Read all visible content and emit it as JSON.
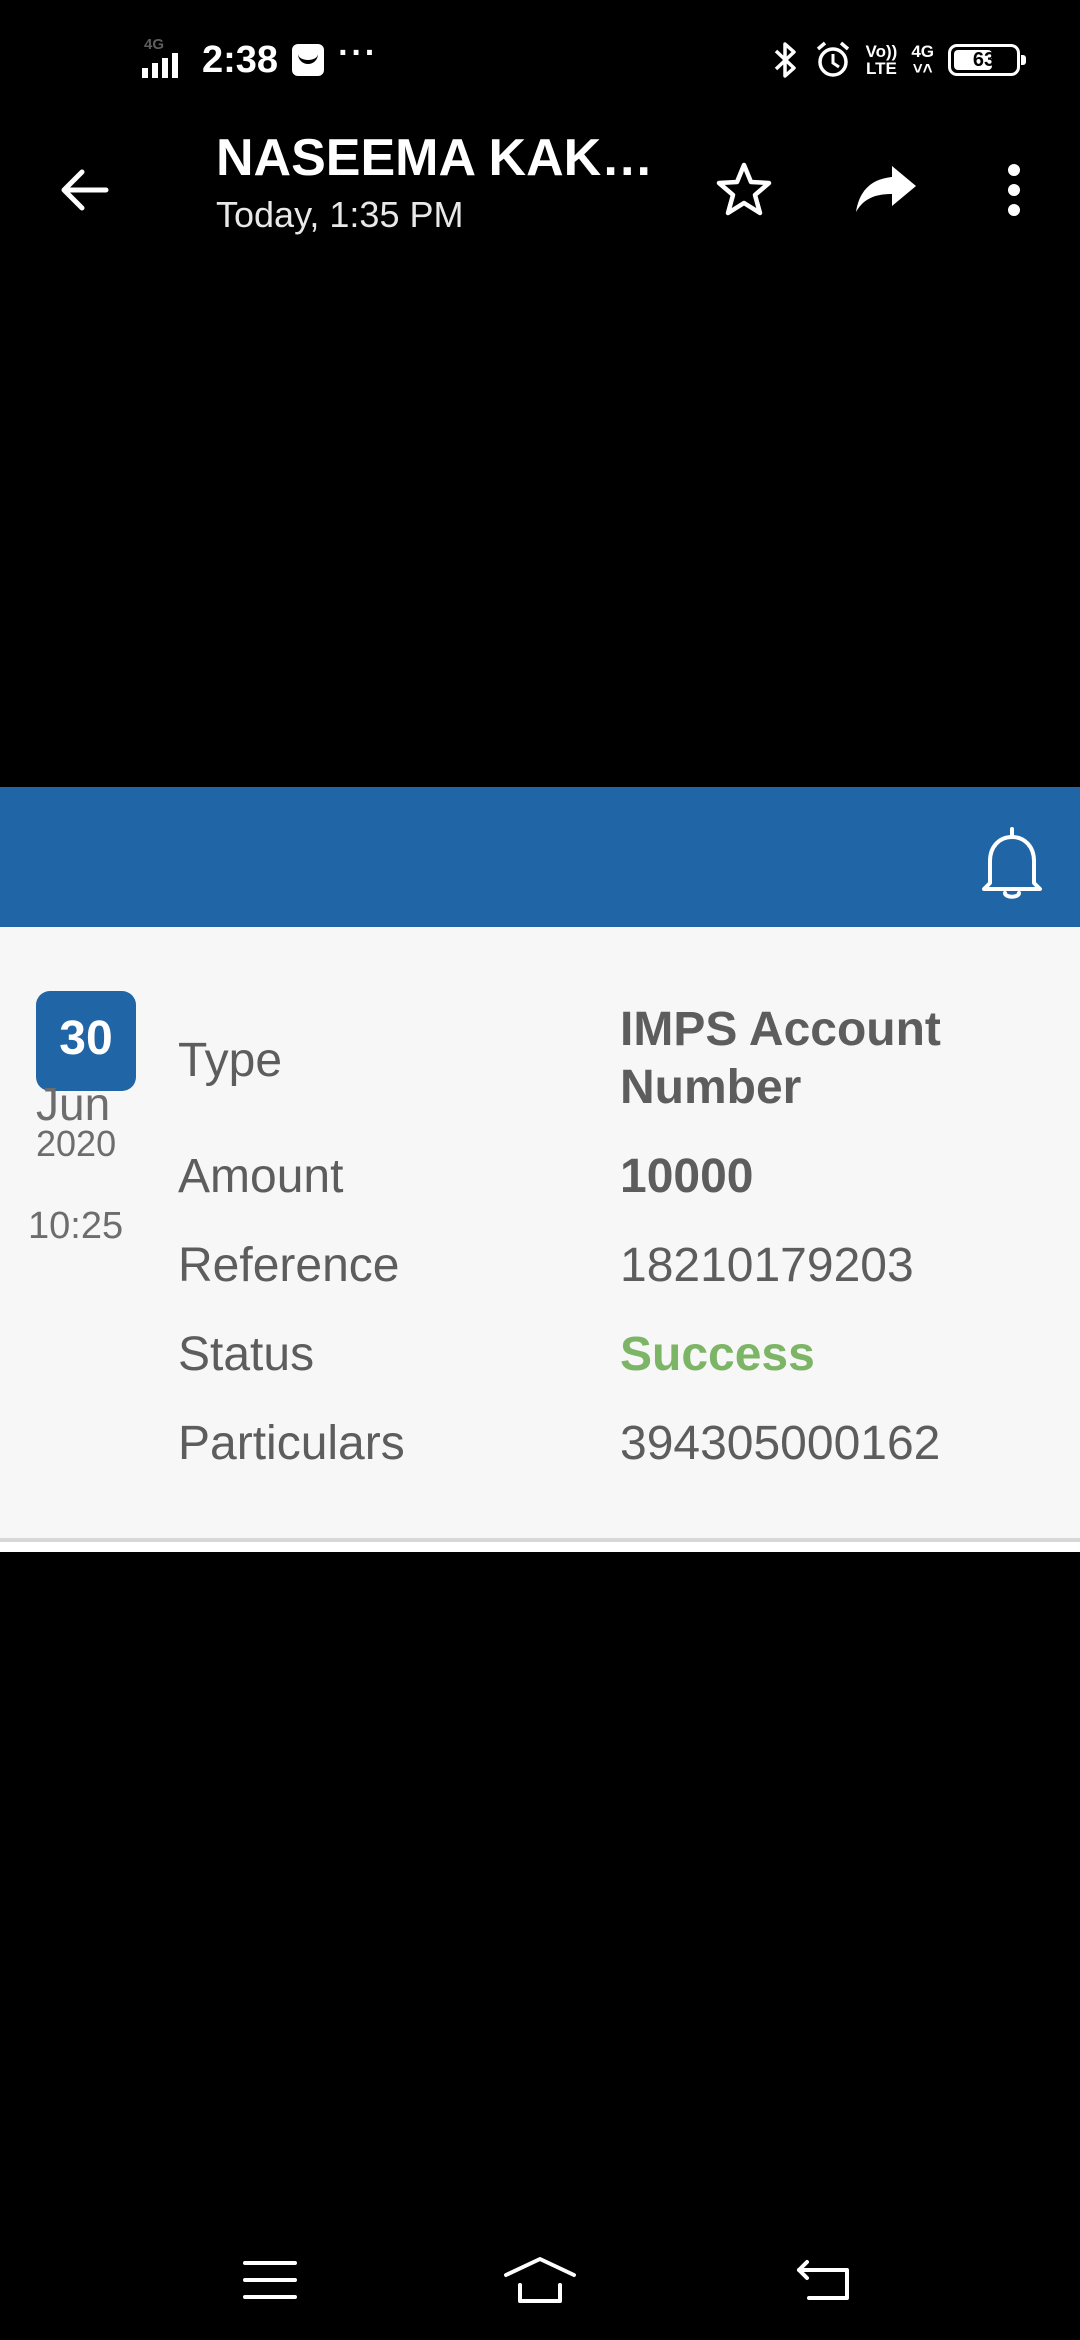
{
  "status_bar": {
    "network_label": "4G",
    "time": "2:38",
    "more": "···",
    "volte_line1": "Vo))",
    "volte_line2": "LTE",
    "net2_line1": "4G",
    "net2_line2": "˅˄",
    "battery_percent": "63",
    "battery_level": 0.63,
    "icons": [
      "signal-icon",
      "message-icon",
      "bluetooth-icon",
      "alarm-icon",
      "volte-icon",
      "battery-icon"
    ]
  },
  "toolbar": {
    "title": "NASEEMA KAKK...",
    "subtitle": "Today, 1:35 PM",
    "icons": [
      "back-arrow-icon",
      "star-icon",
      "share-icon",
      "more-vert-icon"
    ]
  },
  "header_bar": {
    "color": "#2065a5",
    "icon": "bell-icon"
  },
  "transaction": {
    "day": "30",
    "month": "Jun",
    "year": "2020",
    "time": "10:25",
    "rows": [
      {
        "label": "Type",
        "value": "IMPS Account Number"
      },
      {
        "label": "Amount",
        "value": "10000"
      },
      {
        "label": "Reference",
        "value": "18210179203"
      },
      {
        "label": "Status",
        "value": "Success"
      },
      {
        "label": "Particulars",
        "value": "394305000162"
      }
    ],
    "status_color": "#7db567"
  },
  "nav_bar": {
    "icons": [
      "menu-icon",
      "home-icon",
      "back-icon"
    ]
  }
}
